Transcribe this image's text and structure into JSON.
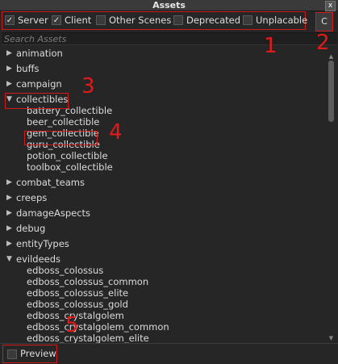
{
  "window": {
    "title": "Assets",
    "close_glyph": "x"
  },
  "filters": [
    {
      "label": "Server",
      "checked": true
    },
    {
      "label": "Client",
      "checked": true
    },
    {
      "label": "Other Scenes",
      "checked": false
    },
    {
      "label": "Deprecated",
      "checked": false
    },
    {
      "label": "Unplacable",
      "checked": false
    }
  ],
  "clear_button": {
    "label": "C"
  },
  "search": {
    "placeholder": "Search Assets",
    "value": ""
  },
  "tree": [
    {
      "label": "animation",
      "expanded": false,
      "depth": 0
    },
    {
      "label": "buffs",
      "expanded": false,
      "depth": 0
    },
    {
      "label": "campaign",
      "expanded": false,
      "depth": 0
    },
    {
      "label": "collectibles",
      "expanded": true,
      "depth": 0
    },
    {
      "label": "battery_collectible",
      "depth": 1
    },
    {
      "label": "beer_collectible",
      "depth": 1
    },
    {
      "label": "gem_collectible",
      "depth": 1
    },
    {
      "label": "guru_collectible",
      "depth": 1
    },
    {
      "label": "potion_collectible",
      "depth": 1
    },
    {
      "label": "toolbox_collectible",
      "depth": 1
    },
    {
      "label": "combat_teams",
      "expanded": false,
      "depth": 0
    },
    {
      "label": "creeps",
      "expanded": false,
      "depth": 0
    },
    {
      "label": "damageAspects",
      "expanded": false,
      "depth": 0
    },
    {
      "label": "debug",
      "expanded": false,
      "depth": 0
    },
    {
      "label": "entityTypes",
      "expanded": false,
      "depth": 0
    },
    {
      "label": "evildeeds",
      "expanded": true,
      "depth": 0
    },
    {
      "label": "edboss_colossus",
      "depth": 1
    },
    {
      "label": "edboss_colossus_common",
      "depth": 1
    },
    {
      "label": "edboss_colossus_elite",
      "depth": 1
    },
    {
      "label": "edboss_colossus_gold",
      "depth": 1
    },
    {
      "label": "edboss_crystalgolem",
      "depth": 1
    },
    {
      "label": "edboss_crystalgolem_common",
      "depth": 1
    },
    {
      "label": "edboss_crystalgolem_elite",
      "depth": 1
    }
  ],
  "scrollbar": {
    "up_glyph": "▲",
    "down_glyph": "▼"
  },
  "footer": {
    "preview_label": "Preview",
    "preview_checked": false
  },
  "annotations": [
    "1",
    "2",
    "3",
    "4",
    "5"
  ],
  "colors": {
    "annotation": "#e11a1a",
    "background": "#262626"
  }
}
